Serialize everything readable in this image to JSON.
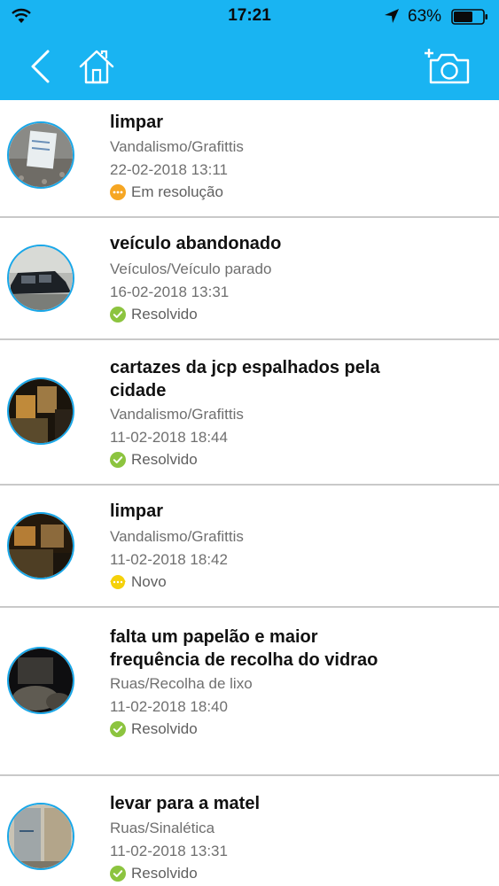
{
  "status_bar": {
    "time": "17:21",
    "battery": "63%"
  },
  "nav": {
    "back_icon": "back-chevron-icon",
    "home_icon": "home-icon",
    "camera_icon": "add-photo-camera-icon"
  },
  "colors": {
    "header": "#19b4f2",
    "avatar_border": "#19a7e8",
    "status_in_progress": "#f6a623",
    "status_resolved": "#8cc43f",
    "status_new": "#f5d10a",
    "delete": "#d4234f"
  },
  "reports": [
    {
      "title_lines": [
        "limpar"
      ],
      "category": "Vandalismo/Grafittis",
      "date": "22-02-2018 13:11",
      "status": "Em resolução",
      "status_icon": "in-progress-icon"
    },
    {
      "title_lines": [
        "veículo abandonado"
      ],
      "category": "Veículos/Veículo parado",
      "date": "16-02-2018 13:31",
      "status": "Resolvido",
      "status_icon": "resolved-check-icon"
    },
    {
      "title_lines": [
        "cartazes da jcp espalhados pela",
        "cidade"
      ],
      "category": "Vandalismo/Grafittis",
      "date": "11-02-2018 18:44",
      "status": "Resolvido",
      "status_icon": "resolved-check-icon"
    },
    {
      "title_lines": [
        "limpar"
      ],
      "category": "Vandalismo/Grafittis",
      "date": "11-02-2018 18:42",
      "status": "Novo",
      "status_icon": "new-icon",
      "delete_icon": "trash-icon"
    },
    {
      "title_lines": [
        "falta um papelão e maior",
        "frequência de recolha do vidrao"
      ],
      "category": "Ruas/Recolha de lixo",
      "date": "11-02-2018 18:40",
      "status": "Resolvido",
      "status_icon": "resolved-check-icon"
    },
    {
      "title_lines": [
        "levar para a matel"
      ],
      "category": "Ruas/Sinalética",
      "date": "11-02-2018 13:31",
      "status": "Resolvido",
      "status_icon": "resolved-check-icon"
    }
  ]
}
